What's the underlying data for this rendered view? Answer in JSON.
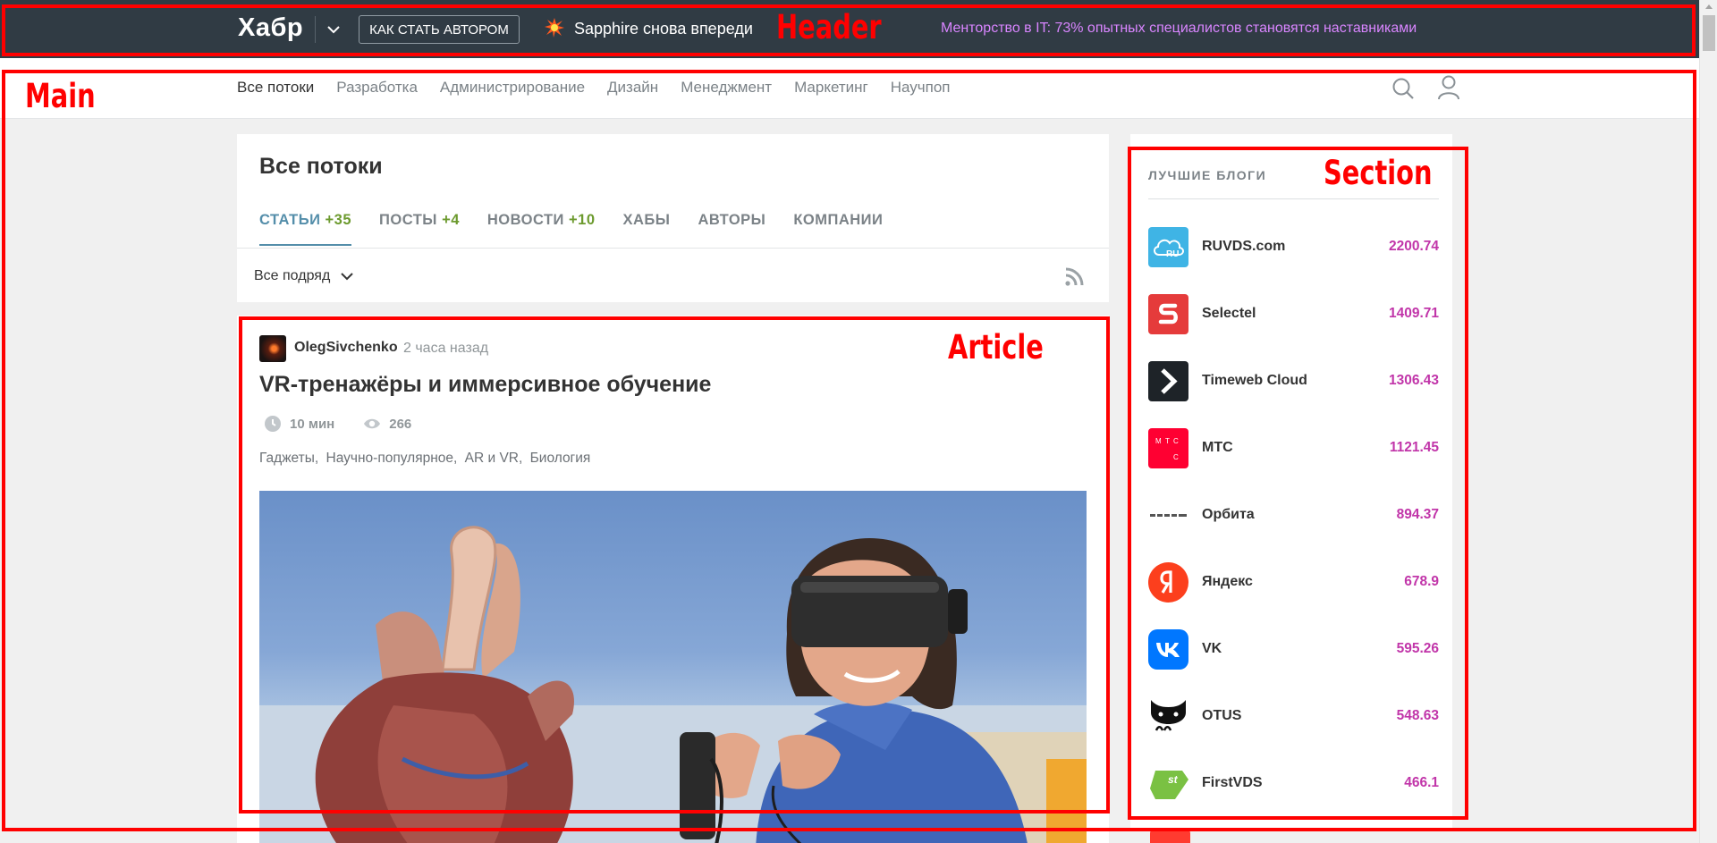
{
  "header": {
    "logo": "Хабр",
    "author_button": "КАК СТАТЬ АВТОРОМ",
    "promo_primary": "Sapphire снова впереди",
    "promo_secondary": "Менторство в IT: 73% опытных специалистов становятся наставниками"
  },
  "nav": {
    "items": [
      "Все потоки",
      "Разработка",
      "Администрирование",
      "Дизайн",
      "Менеджмент",
      "Маркетинг",
      "Научпоп"
    ],
    "active_index": 0
  },
  "feed": {
    "title": "Все потоки",
    "tabs": [
      {
        "label": "СТАТЬИ",
        "count": "+35",
        "active": true
      },
      {
        "label": "ПОСТЫ",
        "count": "+4"
      },
      {
        "label": "НОВОСТИ",
        "count": "+10"
      },
      {
        "label": "ХАБЫ"
      },
      {
        "label": "АВТОРЫ"
      },
      {
        "label": "КОМПАНИИ"
      }
    ],
    "filter": "Все подряд"
  },
  "article": {
    "author": "OlegSivchenko",
    "time": "2 часа назад",
    "title": "VR-тренажёры и иммерсивное обучение",
    "read_time": "10 мин",
    "views": "266",
    "hubs": [
      "Гаджеты,",
      "Научно-популярное,",
      "AR и VR,",
      "Биология"
    ]
  },
  "sidebar": {
    "title": "ЛУЧШИЕ БЛОГИ",
    "blogs": [
      {
        "name": "RUVDS.com",
        "rating": "2200.74",
        "icon": "cloud-icon",
        "color": "#3fb4e5"
      },
      {
        "name": "Selectel",
        "rating": "1409.71",
        "icon": "selectel-icon",
        "color": "#e53b3b"
      },
      {
        "name": "Timeweb Cloud",
        "rating": "1306.43",
        "icon": "chevron-icon",
        "color": "#1e2328"
      },
      {
        "name": "МТС",
        "rating": "1121.45",
        "icon": "mts-icon",
        "color": "#ff0032"
      },
      {
        "name": "Орбита",
        "rating": "894.37",
        "icon": "orbita-icon",
        "color": "#ffffff"
      },
      {
        "name": "Яндекс",
        "rating": "678.9",
        "icon": "yandex-icon",
        "color": "#fc3f1d"
      },
      {
        "name": "VK",
        "rating": "595.26",
        "icon": "vk-icon",
        "color": "#0077ff"
      },
      {
        "name": "OTUS",
        "rating": "548.63",
        "icon": "otus-icon",
        "color": "#ffffff"
      },
      {
        "name": "FirstVDS",
        "rating": "466.1",
        "icon": "firstvds-icon",
        "color": "#7ac143"
      }
    ]
  },
  "annotations": {
    "header": "Header",
    "main": "Main",
    "article": "Article",
    "section": "Section"
  }
}
